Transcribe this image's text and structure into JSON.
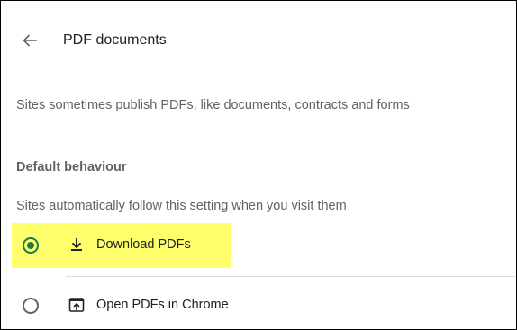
{
  "header": {
    "title": "PDF documents",
    "back_icon": "arrow-left-icon"
  },
  "description": "Sites sometimes publish PDFs, like documents, contracts and forms",
  "default_behaviour": {
    "heading": "Default behaviour",
    "description": "Sites automatically follow this setting when you visit them",
    "options": [
      {
        "label": "Download PDFs",
        "icon": "download-icon",
        "selected": true,
        "highlighted": true
      },
      {
        "label": "Open PDFs in Chrome",
        "icon": "open-in-browser-icon",
        "selected": false,
        "highlighted": false
      }
    ]
  },
  "colors": {
    "radio_selected": "#1a7a43",
    "highlight": "#ffff6b",
    "text_primary": "#202124",
    "text_secondary": "#5f6368",
    "divider": "#dadce0"
  }
}
